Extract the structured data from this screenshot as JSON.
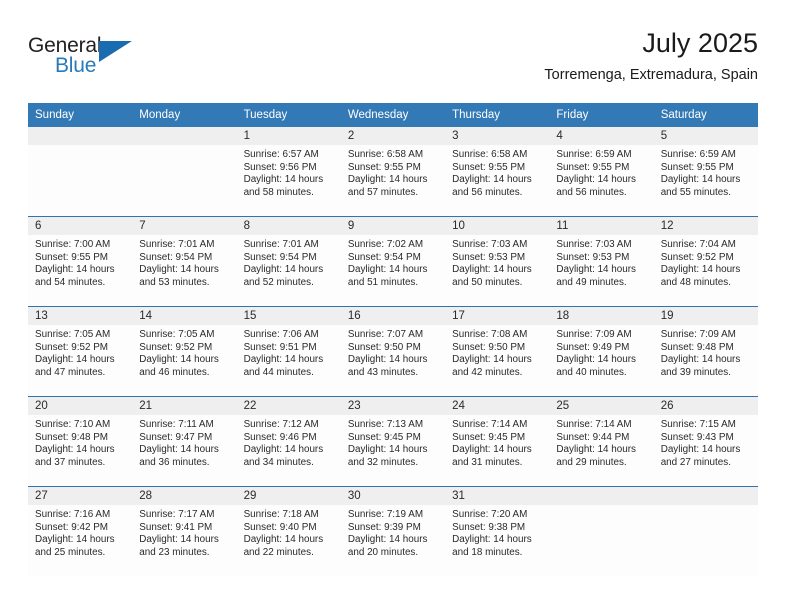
{
  "brand": {
    "name_top": "General",
    "name_bottom": "Blue",
    "accent_color": "#2a7ab9"
  },
  "header": {
    "title": "July 2025",
    "location": "Torremenga, Extremadura, Spain"
  },
  "theme": {
    "header_blue": "#3279b6",
    "row_divider_blue": "#2f74b2",
    "daynum_band": "#efefef"
  },
  "weekdays": [
    "Sunday",
    "Monday",
    "Tuesday",
    "Wednesday",
    "Thursday",
    "Friday",
    "Saturday"
  ],
  "weeks": [
    [
      {
        "day": "",
        "sunrise": "",
        "sunset": "",
        "daylight_1": "",
        "daylight_2": ""
      },
      {
        "day": "",
        "sunrise": "",
        "sunset": "",
        "daylight_1": "",
        "daylight_2": ""
      },
      {
        "day": "1",
        "sunrise": "Sunrise: 6:57 AM",
        "sunset": "Sunset: 9:56 PM",
        "daylight_1": "Daylight: 14 hours",
        "daylight_2": "and 58 minutes."
      },
      {
        "day": "2",
        "sunrise": "Sunrise: 6:58 AM",
        "sunset": "Sunset: 9:55 PM",
        "daylight_1": "Daylight: 14 hours",
        "daylight_2": "and 57 minutes."
      },
      {
        "day": "3",
        "sunrise": "Sunrise: 6:58 AM",
        "sunset": "Sunset: 9:55 PM",
        "daylight_1": "Daylight: 14 hours",
        "daylight_2": "and 56 minutes."
      },
      {
        "day": "4",
        "sunrise": "Sunrise: 6:59 AM",
        "sunset": "Sunset: 9:55 PM",
        "daylight_1": "Daylight: 14 hours",
        "daylight_2": "and 56 minutes."
      },
      {
        "day": "5",
        "sunrise": "Sunrise: 6:59 AM",
        "sunset": "Sunset: 9:55 PM",
        "daylight_1": "Daylight: 14 hours",
        "daylight_2": "and 55 minutes."
      }
    ],
    [
      {
        "day": "6",
        "sunrise": "Sunrise: 7:00 AM",
        "sunset": "Sunset: 9:55 PM",
        "daylight_1": "Daylight: 14 hours",
        "daylight_2": "and 54 minutes."
      },
      {
        "day": "7",
        "sunrise": "Sunrise: 7:01 AM",
        "sunset": "Sunset: 9:54 PM",
        "daylight_1": "Daylight: 14 hours",
        "daylight_2": "and 53 minutes."
      },
      {
        "day": "8",
        "sunrise": "Sunrise: 7:01 AM",
        "sunset": "Sunset: 9:54 PM",
        "daylight_1": "Daylight: 14 hours",
        "daylight_2": "and 52 minutes."
      },
      {
        "day": "9",
        "sunrise": "Sunrise: 7:02 AM",
        "sunset": "Sunset: 9:54 PM",
        "daylight_1": "Daylight: 14 hours",
        "daylight_2": "and 51 minutes."
      },
      {
        "day": "10",
        "sunrise": "Sunrise: 7:03 AM",
        "sunset": "Sunset: 9:53 PM",
        "daylight_1": "Daylight: 14 hours",
        "daylight_2": "and 50 minutes."
      },
      {
        "day": "11",
        "sunrise": "Sunrise: 7:03 AM",
        "sunset": "Sunset: 9:53 PM",
        "daylight_1": "Daylight: 14 hours",
        "daylight_2": "and 49 minutes."
      },
      {
        "day": "12",
        "sunrise": "Sunrise: 7:04 AM",
        "sunset": "Sunset: 9:52 PM",
        "daylight_1": "Daylight: 14 hours",
        "daylight_2": "and 48 minutes."
      }
    ],
    [
      {
        "day": "13",
        "sunrise": "Sunrise: 7:05 AM",
        "sunset": "Sunset: 9:52 PM",
        "daylight_1": "Daylight: 14 hours",
        "daylight_2": "and 47 minutes."
      },
      {
        "day": "14",
        "sunrise": "Sunrise: 7:05 AM",
        "sunset": "Sunset: 9:52 PM",
        "daylight_1": "Daylight: 14 hours",
        "daylight_2": "and 46 minutes."
      },
      {
        "day": "15",
        "sunrise": "Sunrise: 7:06 AM",
        "sunset": "Sunset: 9:51 PM",
        "daylight_1": "Daylight: 14 hours",
        "daylight_2": "and 44 minutes."
      },
      {
        "day": "16",
        "sunrise": "Sunrise: 7:07 AM",
        "sunset": "Sunset: 9:50 PM",
        "daylight_1": "Daylight: 14 hours",
        "daylight_2": "and 43 minutes."
      },
      {
        "day": "17",
        "sunrise": "Sunrise: 7:08 AM",
        "sunset": "Sunset: 9:50 PM",
        "daylight_1": "Daylight: 14 hours",
        "daylight_2": "and 42 minutes."
      },
      {
        "day": "18",
        "sunrise": "Sunrise: 7:09 AM",
        "sunset": "Sunset: 9:49 PM",
        "daylight_1": "Daylight: 14 hours",
        "daylight_2": "and 40 minutes."
      },
      {
        "day": "19",
        "sunrise": "Sunrise: 7:09 AM",
        "sunset": "Sunset: 9:48 PM",
        "daylight_1": "Daylight: 14 hours",
        "daylight_2": "and 39 minutes."
      }
    ],
    [
      {
        "day": "20",
        "sunrise": "Sunrise: 7:10 AM",
        "sunset": "Sunset: 9:48 PM",
        "daylight_1": "Daylight: 14 hours",
        "daylight_2": "and 37 minutes."
      },
      {
        "day": "21",
        "sunrise": "Sunrise: 7:11 AM",
        "sunset": "Sunset: 9:47 PM",
        "daylight_1": "Daylight: 14 hours",
        "daylight_2": "and 36 minutes."
      },
      {
        "day": "22",
        "sunrise": "Sunrise: 7:12 AM",
        "sunset": "Sunset: 9:46 PM",
        "daylight_1": "Daylight: 14 hours",
        "daylight_2": "and 34 minutes."
      },
      {
        "day": "23",
        "sunrise": "Sunrise: 7:13 AM",
        "sunset": "Sunset: 9:45 PM",
        "daylight_1": "Daylight: 14 hours",
        "daylight_2": "and 32 minutes."
      },
      {
        "day": "24",
        "sunrise": "Sunrise: 7:14 AM",
        "sunset": "Sunset: 9:45 PM",
        "daylight_1": "Daylight: 14 hours",
        "daylight_2": "and 31 minutes."
      },
      {
        "day": "25",
        "sunrise": "Sunrise: 7:14 AM",
        "sunset": "Sunset: 9:44 PM",
        "daylight_1": "Daylight: 14 hours",
        "daylight_2": "and 29 minutes."
      },
      {
        "day": "26",
        "sunrise": "Sunrise: 7:15 AM",
        "sunset": "Sunset: 9:43 PM",
        "daylight_1": "Daylight: 14 hours",
        "daylight_2": "and 27 minutes."
      }
    ],
    [
      {
        "day": "27",
        "sunrise": "Sunrise: 7:16 AM",
        "sunset": "Sunset: 9:42 PM",
        "daylight_1": "Daylight: 14 hours",
        "daylight_2": "and 25 minutes."
      },
      {
        "day": "28",
        "sunrise": "Sunrise: 7:17 AM",
        "sunset": "Sunset: 9:41 PM",
        "daylight_1": "Daylight: 14 hours",
        "daylight_2": "and 23 minutes."
      },
      {
        "day": "29",
        "sunrise": "Sunrise: 7:18 AM",
        "sunset": "Sunset: 9:40 PM",
        "daylight_1": "Daylight: 14 hours",
        "daylight_2": "and 22 minutes."
      },
      {
        "day": "30",
        "sunrise": "Sunrise: 7:19 AM",
        "sunset": "Sunset: 9:39 PM",
        "daylight_1": "Daylight: 14 hours",
        "daylight_2": "and 20 minutes."
      },
      {
        "day": "31",
        "sunrise": "Sunrise: 7:20 AM",
        "sunset": "Sunset: 9:38 PM",
        "daylight_1": "Daylight: 14 hours",
        "daylight_2": "and 18 minutes."
      },
      {
        "day": "",
        "sunrise": "",
        "sunset": "",
        "daylight_1": "",
        "daylight_2": ""
      },
      {
        "day": "",
        "sunrise": "",
        "sunset": "",
        "daylight_1": "",
        "daylight_2": ""
      }
    ]
  ]
}
